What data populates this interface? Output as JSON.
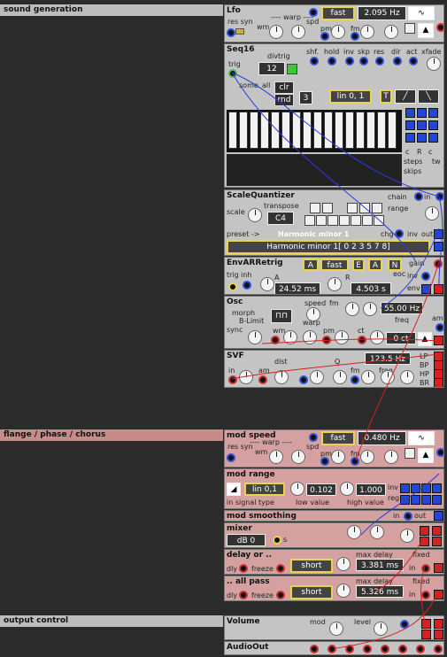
{
  "sections": [
    {
      "label": "sound generation"
    },
    {
      "label": "flange / phase / chorus"
    },
    {
      "label": "output control"
    }
  ],
  "lfo": {
    "title": "Lfo",
    "mode": "fast",
    "freq": "2.095 Hz",
    "labels": {
      "res_syn": "res syn",
      "warp": "---- warp ----",
      "wm": "wm",
      "spd": "spd",
      "pm": "pm",
      "fm": "fm"
    }
  },
  "seq16": {
    "title": "Seq16",
    "divtrig": "divtrig",
    "trig": "trig",
    "divtrig_val": "12",
    "clr": "clr",
    "rnd": "rnd",
    "steps_val": "3",
    "interp": "lin 0, 1",
    "t": "T",
    "some": "some",
    "all": "all",
    "shf": "shf.",
    "hold": "hold",
    "inv": "inv",
    "skp": "skp",
    "res": "res",
    "dir": "dir",
    "act": "act",
    "xfade": "xfade",
    "c": "c",
    "r": "R",
    "tw": "tw",
    "steps": "steps",
    "skips": "skips"
  },
  "scalequantizer": {
    "title": "ScaleQuantizer",
    "chain": "chain",
    "in": "in",
    "scale": "scale",
    "transpose": "transpose",
    "note": "C4",
    "range": "range",
    "preset": "preset ->",
    "preset_name": "Harmonic minor 1",
    "chg": "chg",
    "inv": "inv",
    "out": "out",
    "scale_display": "Harmonic minor 1[ 0 2 3 5 7 8]"
  },
  "envar": {
    "title": "EnvARRetrig",
    "a": "A",
    "mode": "fast",
    "e": "E",
    "a2": "A",
    "n": "N",
    "trig": "trig",
    "inh": "inh",
    "a_lbl": "A",
    "r_lbl": "R",
    "attack": "24.52 ms",
    "release": "4.503 s",
    "gain": "gain",
    "inv": "inv",
    "eoc": "eoc",
    "env": "env"
  },
  "osc": {
    "title": "Osc",
    "morph": "morph",
    "blimit": "B-Limit",
    "speed": "speed",
    "fm": "fm",
    "freq_val": "55.00 Hz",
    "sync": "sync",
    "wm": "wm",
    "warp": "warp",
    "pm": "pm",
    "ct": "ct",
    "freq": "freq",
    "cents": "0 ct",
    "am": "am"
  },
  "svf": {
    "title": "SVF",
    "freq": "123.5 Hz",
    "dist": "dist",
    "in": "in",
    "am": "am",
    "q": "Q",
    "fm": "fm",
    "freq_lbl": "freq",
    "lp": "LP",
    "bp": "BP",
    "hp": "HP",
    "br": "BR"
  },
  "modspeed": {
    "title": "mod speed",
    "mode": "fast",
    "freq": "0.480 Hz",
    "res_syn": "res syn",
    "warp": "---- warp ----",
    "wm": "wm",
    "spd": "spd",
    "pm": "pm",
    "fm": "fm"
  },
  "modrange": {
    "title": "mod range",
    "interp": "lin 0,1",
    "low": "0.102",
    "high": "1.000",
    "in_signal": "in signal type",
    "low_lbl": "low value",
    "high_lbl": "high value",
    "inv": "inv",
    "reg": "reg"
  },
  "modsmooth": {
    "title": "mod smoothing",
    "in": "in",
    "out": "out"
  },
  "mixer": {
    "title": "mixer",
    "gain": "dB 0",
    "s": "s"
  },
  "delay1": {
    "title": "delay or ..",
    "dly": "dly",
    "freeze": "freeze",
    "mode": "short",
    "max": "max delay",
    "val": "3.381 ms",
    "fixed": "fixed",
    "in": "in"
  },
  "delay2": {
    "title": ".. all pass",
    "dly": "dly",
    "freeze": "freeze",
    "mode": "short",
    "max": "max delay",
    "val": "5.326 ms",
    "fixed": "fixed",
    "in": "in"
  },
  "volume": {
    "title": "Volume",
    "mod": "mod",
    "level": "level"
  },
  "audioout": {
    "title": "AudioOut"
  },
  "colors": {
    "cable_blue": "#2a3cd8",
    "cable_red": "#d82020",
    "panel_gray": "#c4c4c4",
    "panel_pink": "#d4a0a0"
  }
}
